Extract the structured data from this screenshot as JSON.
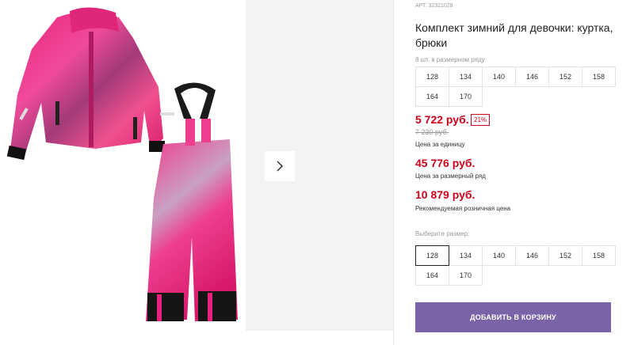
{
  "product": {
    "article": "АРТ. 32321028",
    "title": "Комплект зимний для девочки: куртка, брюки"
  },
  "size_row": {
    "hint": "8 шт. в размерном ряду",
    "sizes": [
      "128",
      "134",
      "140",
      "146",
      "152",
      "158",
      "164",
      "170"
    ]
  },
  "prices": {
    "unit_price": "5 722 руб.",
    "discount": "21%",
    "old_price": "7 230 руб.",
    "unit_label": "Цена за единицу",
    "row_price": "45 776 руб.",
    "row_label": "Цена за размерный ряд",
    "retail_price": "10 879 руб.",
    "retail_label": "Рекомендуемая розничная цена"
  },
  "size_select": {
    "hint": "Выберите размер:",
    "sizes": [
      "128",
      "134",
      "140",
      "146",
      "152",
      "158",
      "164",
      "170"
    ],
    "selected": "128"
  },
  "actions": {
    "add_to_cart": "ДОБАВИТЬ В КОРЗИНУ"
  },
  "colors": {
    "accent": "#7a63a7",
    "price": "#d0021b",
    "product_pink": "#e8227a"
  },
  "icons": {
    "next": "chevron-right-icon"
  }
}
